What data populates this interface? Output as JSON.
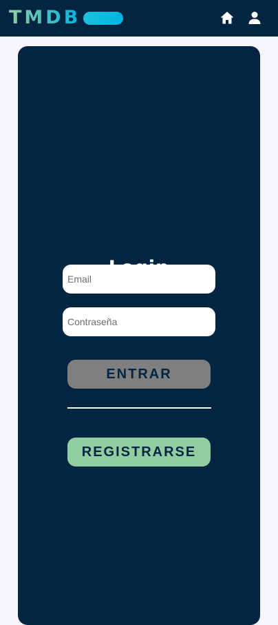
{
  "navbar": {
    "logo_text": "TMDB",
    "home_icon": "home-icon",
    "user_icon": "user-icon"
  },
  "login": {
    "title": "Login",
    "email_placeholder": "Email",
    "password_placeholder": "Contraseña",
    "login_button": "ENTRAR",
    "register_button": "REGISTRARSE"
  },
  "colors": {
    "navy": "#032541",
    "page_background": "#f7f6fd",
    "login_button": "#7f7f7f",
    "register_button": "#90cea1",
    "brand_green": "#90cea1",
    "brand_blue": "#01b4e4"
  }
}
